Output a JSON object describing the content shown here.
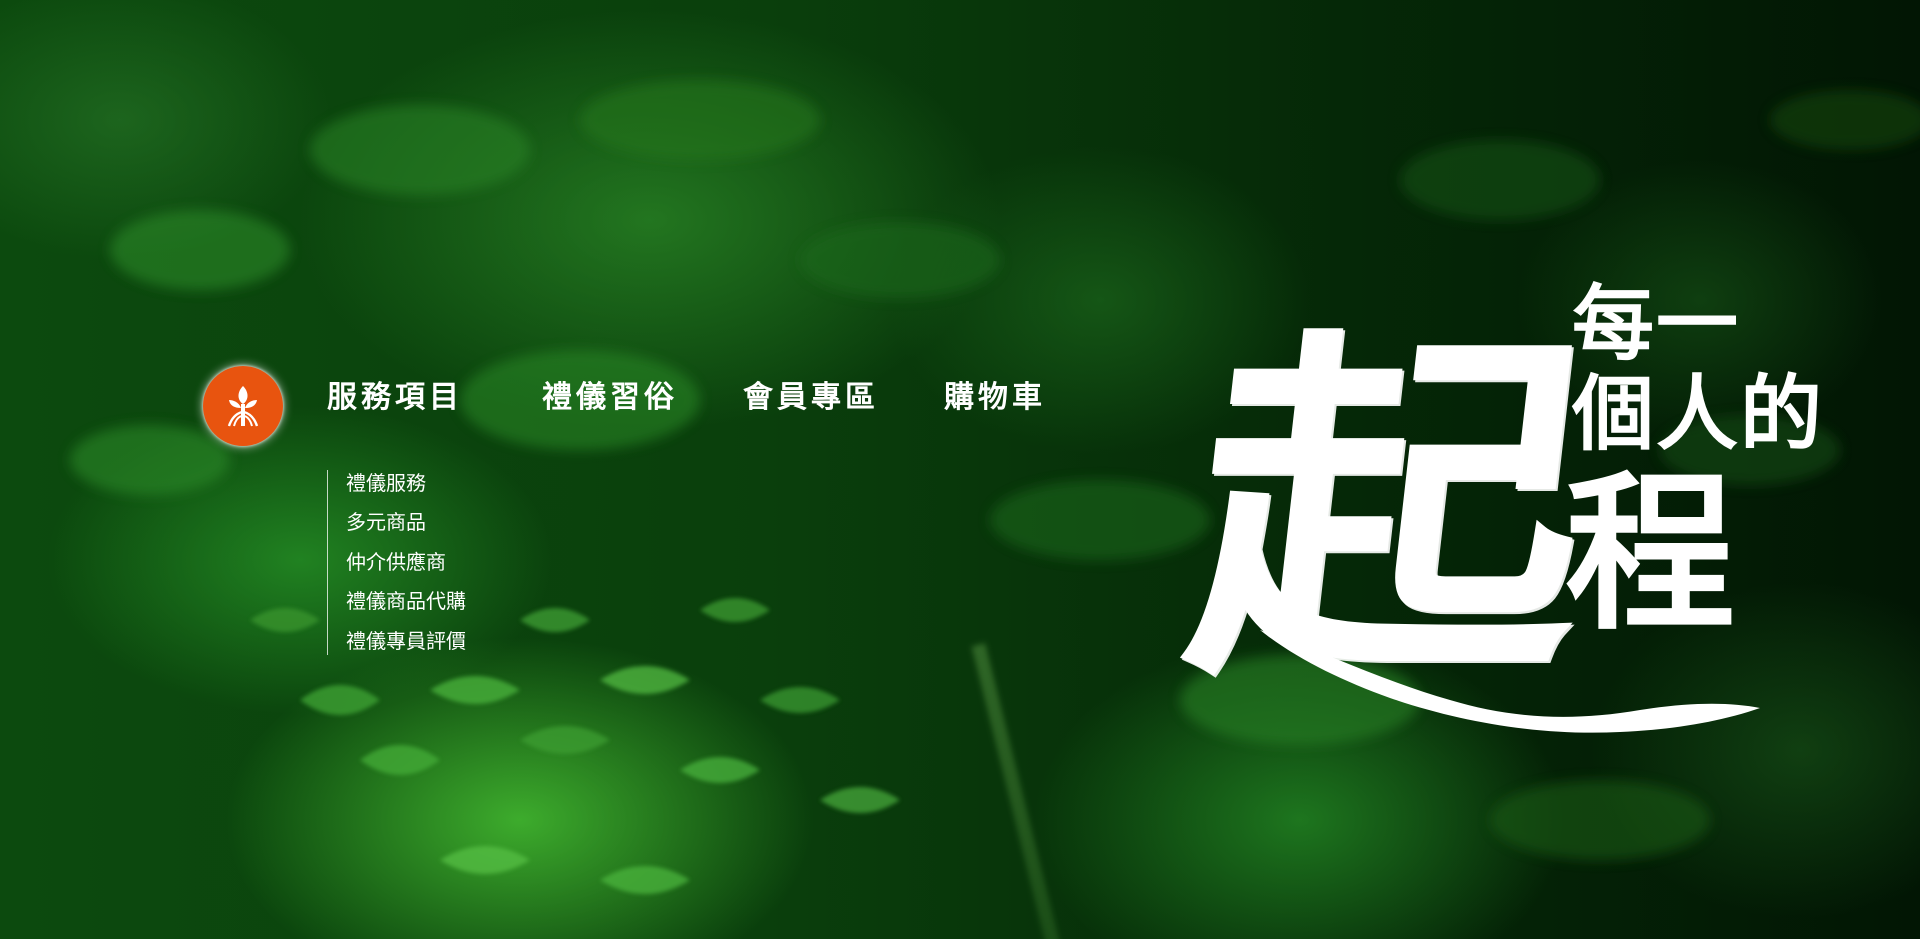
{
  "brand": {
    "logo_icon": "sprout-logo-icon",
    "logo_color": "#e8540f"
  },
  "nav": {
    "items": [
      {
        "label": "服務項目"
      },
      {
        "label": "禮儀習俗"
      },
      {
        "label": "會員專區"
      },
      {
        "label": "購物車"
      }
    ]
  },
  "submenu": {
    "items": [
      {
        "label": "禮儀服務"
      },
      {
        "label": "多元商品"
      },
      {
        "label": "仲介供應商"
      },
      {
        "label": "禮儀商品代購"
      },
      {
        "label": "禮儀專員評價"
      }
    ]
  },
  "hero": {
    "calligraphy_char": "起",
    "line1": "每一",
    "line2": "個人的",
    "line3": "程"
  },
  "colors": {
    "text": "#ffffff",
    "background": "#0a3f0c"
  }
}
